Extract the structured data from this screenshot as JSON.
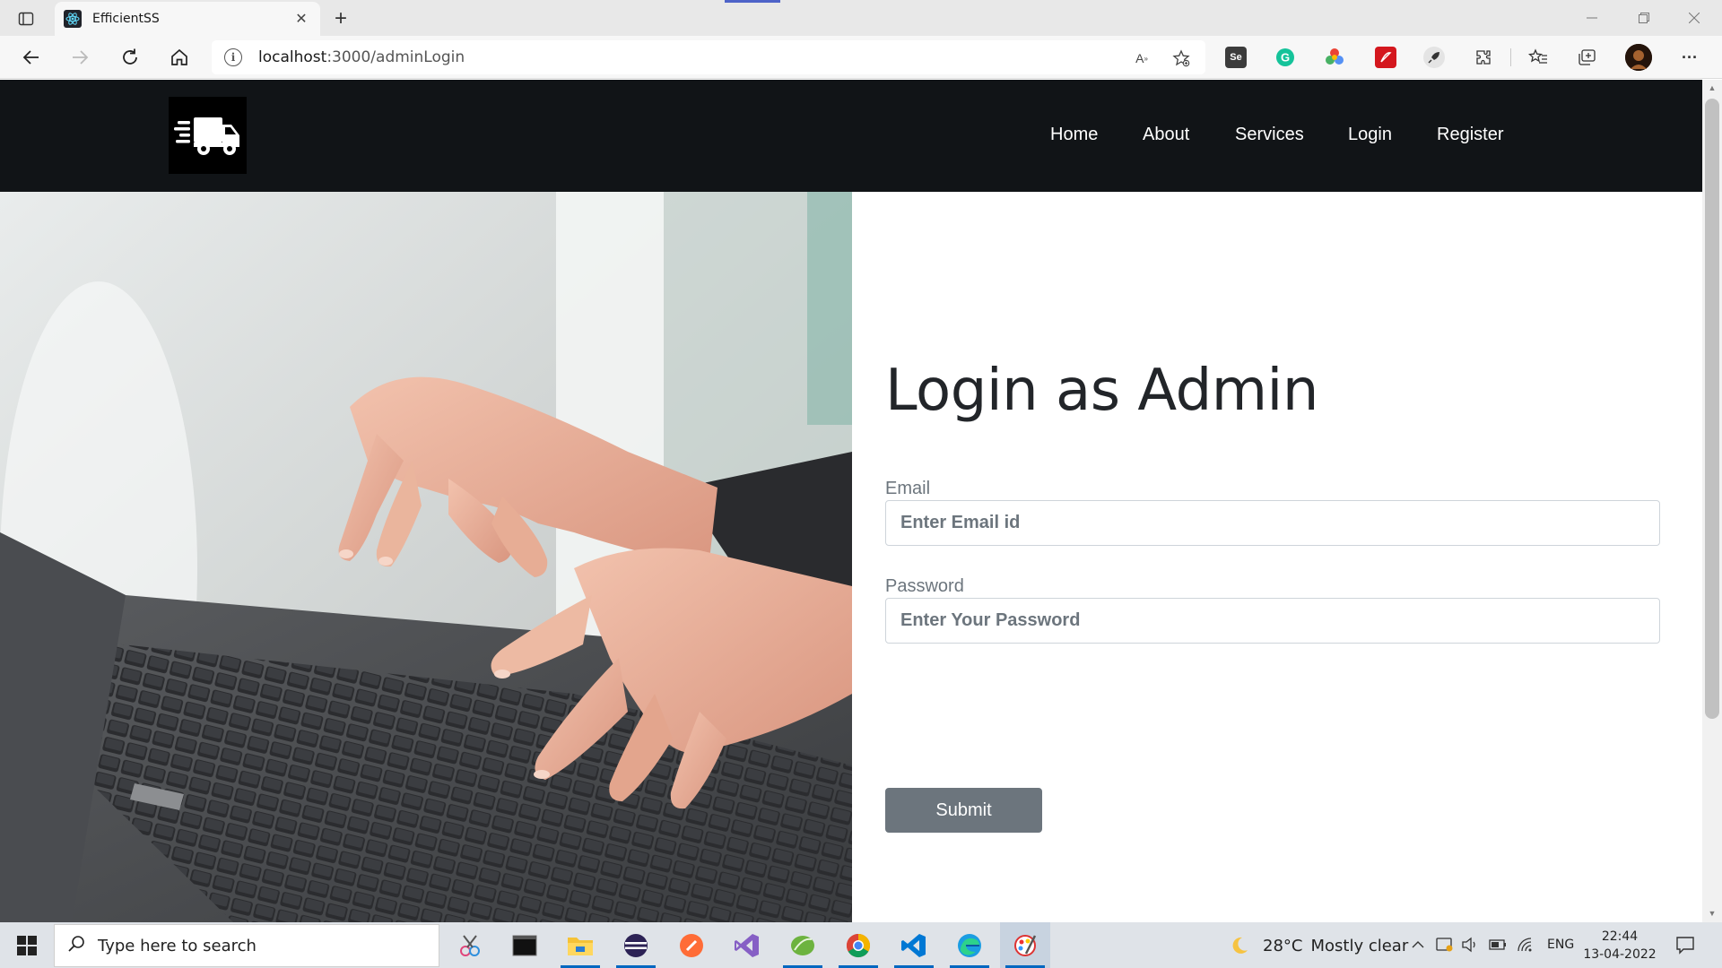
{
  "browser": {
    "tab_title": "EfficientSS",
    "url_host": "localhost",
    "url_path": ":3000/adminLogin"
  },
  "site": {
    "logo_icon": "delivery-truck-icon",
    "nav": [
      {
        "label": "Home"
      },
      {
        "label": "About"
      },
      {
        "label": "Services"
      },
      {
        "label": "Login"
      },
      {
        "label": "Register"
      }
    ]
  },
  "login": {
    "heading": "Login as Admin",
    "email_label": "Email",
    "email_placeholder": "Enter Email id",
    "email_value": "",
    "password_label": "Password",
    "password_placeholder": "Enter Your Password",
    "password_value": "",
    "submit_label": "Submit"
  },
  "taskbar": {
    "search_placeholder": "Type here to search",
    "weather_temp": "28°C",
    "weather_text": "Mostly clear",
    "language": "ENG",
    "time": "22:44",
    "date": "13-04-2022"
  },
  "colors": {
    "navbar_bg": "#111417",
    "submit_bg": "#6c757d",
    "heading_text": "#222529"
  }
}
